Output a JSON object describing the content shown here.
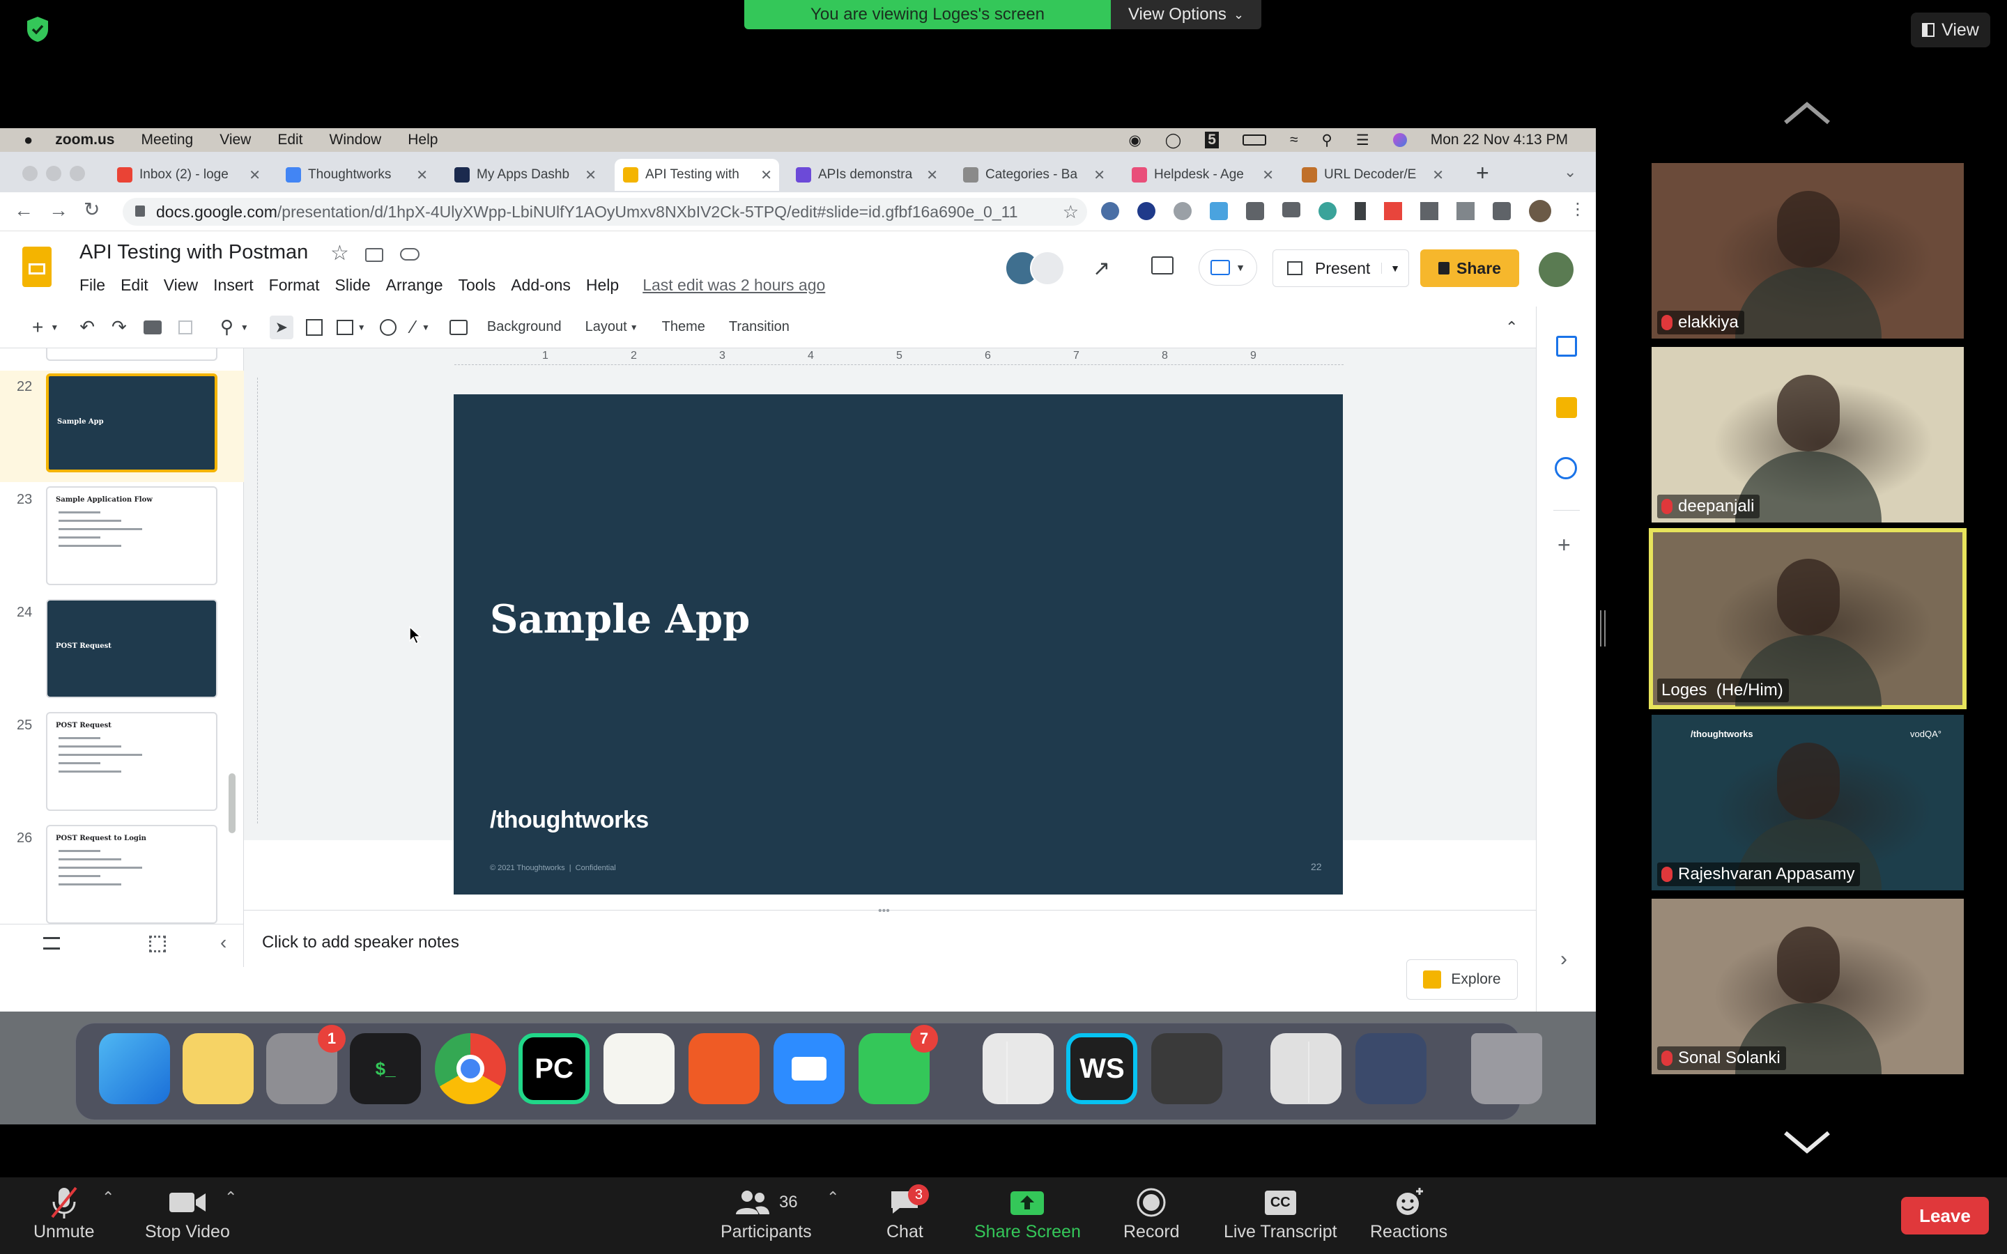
{
  "zoom_top": {
    "viewing_banner": "You are viewing Loges's screen",
    "view_options": "View Options",
    "view_button": "View"
  },
  "mac_menubar": {
    "app_name": "zoom.us",
    "items": [
      "Meeting",
      "View",
      "Edit",
      "Window",
      "Help"
    ],
    "clock": "Mon 22 Nov  4:13 PM"
  },
  "browser": {
    "tabs": [
      {
        "title": "Inbox (2) - loge",
        "color": "#ea4335"
      },
      {
        "title": "Thoughtworks",
        "color": "#4285f4"
      },
      {
        "title": "My Apps Dashb",
        "color": "#1b2a4e"
      },
      {
        "title": "API Testing with",
        "color": "#f4b400"
      },
      {
        "title": "APIs demonstra",
        "color": "#6c4ad8"
      },
      {
        "title": "Categories - Ba",
        "color": "#8a8a8a"
      },
      {
        "title": "Helpdesk - Age",
        "color": "#e94f7a"
      },
      {
        "title": "URL Decoder/E",
        "color": "#c0702a"
      }
    ],
    "url_host": "docs.google.com",
    "url_path": "/presentation/d/1hpX-4UlyXWpp-LbiNUlfY1AOyUmxv8NXbIV2Ck-5TPQ/edit#slide=id.gfbf16a690e_0_11"
  },
  "slides": {
    "doc_title": "API Testing with Postman",
    "menu": [
      "File",
      "Edit",
      "View",
      "Insert",
      "Format",
      "Slide",
      "Arrange",
      "Tools",
      "Add-ons",
      "Help"
    ],
    "last_edit": "Last edit was 2 hours ago",
    "present_label": "Present",
    "share_label": "Share",
    "toolbar": {
      "background": "Background",
      "layout": "Layout",
      "theme": "Theme",
      "transition": "Transition"
    },
    "ruler_marks": [
      "1",
      "2",
      "3",
      "4",
      "5",
      "6",
      "7",
      "8",
      "9"
    ],
    "thumbnails": [
      {
        "num": "22",
        "title": "Sample App",
        "dark": true,
        "selected": true
      },
      {
        "num": "23",
        "title": "Sample Application Flow",
        "dark": false,
        "selected": false
      },
      {
        "num": "24",
        "title": "POST Request",
        "dark": true,
        "selected": false
      },
      {
        "num": "25",
        "title": "POST Request",
        "dark": false,
        "selected": false
      },
      {
        "num": "26",
        "title": "POST Request to Login",
        "dark": false,
        "selected": false
      }
    ],
    "slide": {
      "title": "Sample App",
      "logo": "/thoughtworks",
      "footer": "© 2021 Thoughtworks  |  Confidential",
      "page_number": "22",
      "bg_color": "#1f3a4d"
    },
    "speaker_notes_placeholder": "Click to add speaker notes",
    "explore_label": "Explore"
  },
  "dock": {
    "apps": [
      {
        "name": "Finder",
        "icon": "finder-icon"
      },
      {
        "name": "Notes",
        "icon": "notes-icon"
      },
      {
        "name": "System Preferences",
        "icon": "gear-icon",
        "badge": "1"
      },
      {
        "name": "Terminal",
        "icon": "terminal-icon"
      },
      {
        "name": "Chrome",
        "icon": "chrome-icon"
      },
      {
        "name": "PyCharm",
        "icon": "pycharm-icon"
      },
      {
        "name": "TextEdit",
        "icon": "textedit-icon"
      },
      {
        "name": "Postman",
        "icon": "postman-icon"
      },
      {
        "name": "Zoom",
        "icon": "zoom-icon"
      },
      {
        "name": "Messages",
        "icon": "chat-icon",
        "badge": "7"
      },
      {
        "name": "1Password",
        "icon": "password-icon"
      },
      {
        "name": "WebStorm",
        "icon": "webstorm-icon"
      },
      {
        "name": "Sublime Text",
        "icon": "sublime-icon"
      },
      {
        "name": "Downloads",
        "icon": "downloads-icon"
      },
      {
        "name": "Recent",
        "icon": "recent-icon"
      },
      {
        "name": "Trash",
        "icon": "trash-icon"
      }
    ],
    "terminal_glyph": "$_",
    "pycharm_glyph": "PC",
    "webstorm_glyph": "WS"
  },
  "participants_gallery": [
    {
      "name": "elakkiya",
      "muted": true,
      "bg": "#6b4b3a"
    },
    {
      "name": "deepanjali",
      "muted": true,
      "bg": "#d9d1b8"
    },
    {
      "name": "Loges  (He/Him)",
      "muted": false,
      "bg": "#7a6a56",
      "active_speaker": true
    },
    {
      "name": "Rajeshvaran Appasamy",
      "muted": true,
      "bg": "#1d3e4b",
      "banner_left": "/thoughtworks",
      "banner_right": "vodQA°"
    },
    {
      "name": "Sonal Solanki",
      "muted": true,
      "bg": "#9a8a78"
    }
  ],
  "zoom_bar": {
    "unmute": "Unmute",
    "stop_video": "Stop Video",
    "participants": "Participants",
    "participants_count": "36",
    "chat": "Chat",
    "chat_badge": "3",
    "share_screen": "Share Screen",
    "record": "Record",
    "live_transcript": "Live Transcript",
    "reactions": "Reactions",
    "leave": "Leave",
    "cc_glyph": "CC",
    "accent": "#34c759",
    "leave_color": "#e0383b"
  }
}
